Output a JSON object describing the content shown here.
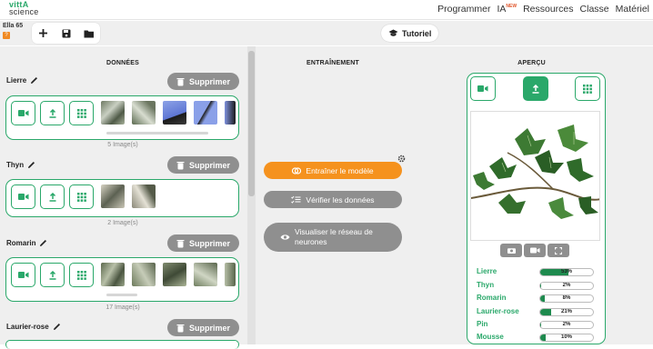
{
  "nav": {
    "logo_line1": "vittA",
    "logo_line2": "science",
    "links": [
      "Programmer",
      "IA",
      "Ressources",
      "Classe",
      "Matériel"
    ],
    "new_badge": "NEW"
  },
  "project": {
    "name": "Ella 65",
    "badge": "?"
  },
  "toolbar": {
    "buttons": [
      "+",
      "💾",
      "📂"
    ]
  },
  "tutoriel": "Tutoriel",
  "columns": {
    "data": "DONNÉES",
    "training": "ENTRAÎNEMENT",
    "preview": "APERÇU"
  },
  "delete_label": "Supprimer",
  "classes": [
    {
      "name": "Lierre",
      "count": "5 Image(s)"
    },
    {
      "name": "Thyn",
      "count": "2 Image(s)"
    },
    {
      "name": "Romarin",
      "count": "17 Image(s)"
    },
    {
      "name": "Laurier-rose",
      "count": ""
    }
  ],
  "training": {
    "train": "Entraîner le modèle",
    "verify": "Vérifier les données",
    "visualize": "Visualiser le réseau de neurones"
  },
  "colors": {
    "accent": "#2aa86a",
    "orange": "#f5921e",
    "gray": "#8f8f8f"
  },
  "predictions": [
    {
      "name": "Lierre",
      "value": 53,
      "label": "53%"
    },
    {
      "name": "Thyn",
      "value": 2,
      "label": "2%"
    },
    {
      "name": "Romarin",
      "value": 8,
      "label": "8%"
    },
    {
      "name": "Laurier-rose",
      "value": 21,
      "label": "21%"
    },
    {
      "name": "Pin",
      "value": 2,
      "label": "2%"
    },
    {
      "name": "Mousse",
      "value": 10,
      "label": "10%"
    }
  ]
}
